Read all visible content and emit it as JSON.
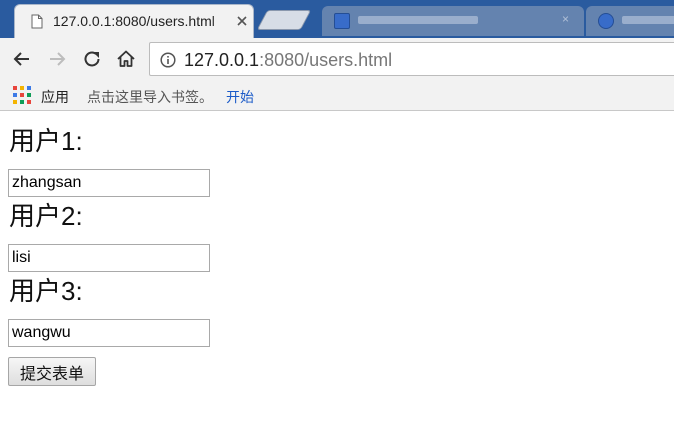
{
  "browser": {
    "active_tab": {
      "title": "127.0.0.1:8080/users.html",
      "favicon": "page-icon"
    },
    "address_bar": {
      "host": "127.0.0.1",
      "rest": ":8080/users.html",
      "icon": "info-icon"
    },
    "nav": {
      "back_icon": "back-arrow-icon",
      "forward_icon": "forward-arrow-icon",
      "reload_icon": "reload-icon",
      "home_icon": "home-icon"
    },
    "bookmarks": {
      "apps_label": "应用",
      "hint": "点击这里导入书签。",
      "start_link": "开始"
    },
    "colors": {
      "tabstrip": "#2a5b9f",
      "toolbar": "#f2f2f2",
      "link": "#1a5ac8"
    }
  },
  "form": {
    "users": [
      {
        "label": "用户1:",
        "value": "zhangsan"
      },
      {
        "label": "用户2:",
        "value": "lisi"
      },
      {
        "label": "用户3:",
        "value": "wangwu"
      }
    ],
    "submit_label": "提交表单"
  }
}
